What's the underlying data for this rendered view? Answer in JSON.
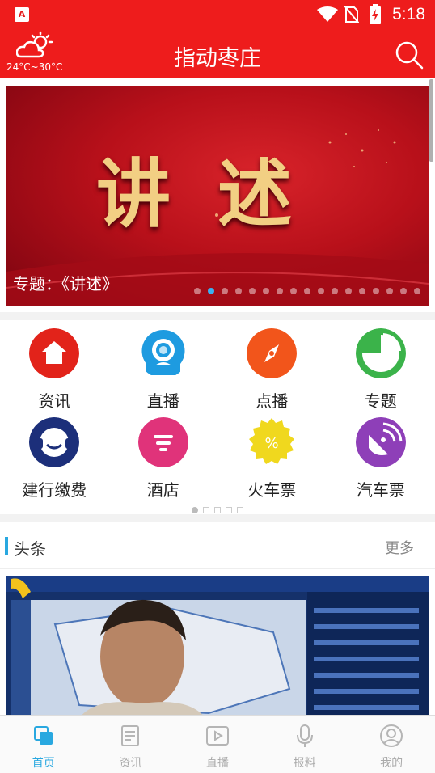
{
  "status_bar": {
    "app_icon": "A",
    "time": "5:18",
    "icons": [
      "wifi-icon",
      "no-sim-icon",
      "battery-charging-icon"
    ]
  },
  "app_bar": {
    "title": "指动枣庄",
    "weather_icon": "partly-cloudy-icon",
    "temperature": "24°C~30°C",
    "search_icon": "search-icon"
  },
  "banner": {
    "big_text": "讲述",
    "caption": "专题：《讲述》",
    "slide_count": 17,
    "active_slide": 2
  },
  "services": {
    "items": [
      {
        "label": "资讯",
        "icon": "home-icon",
        "color": "#e2231a"
      },
      {
        "label": "直播",
        "icon": "webcam-icon",
        "color": "#1e9be0"
      },
      {
        "label": "点播",
        "icon": "compass-icon",
        "color": "#f2551b"
      },
      {
        "label": "专题",
        "icon": "pie-chart-icon",
        "color": "#3bb34a"
      },
      {
        "label": "建行缴费",
        "icon": "headset-icon",
        "color": "#1c2f7a"
      },
      {
        "label": "酒店",
        "icon": "hotel-icon",
        "color": "#e0337a"
      },
      {
        "label": "火车票",
        "icon": "train-ticket-icon",
        "color": "#f0d81e"
      },
      {
        "label": "汽车票",
        "icon": "satellite-icon",
        "color": "#8e3fb8"
      }
    ],
    "page_count": 5,
    "active_page": 1
  },
  "headlines": {
    "title": "头条",
    "more": "更多"
  },
  "tab_bar": {
    "tabs": [
      {
        "label": "首页",
        "icon": "home-tab-icon",
        "active": true
      },
      {
        "label": "资讯",
        "icon": "news-icon",
        "active": false
      },
      {
        "label": "直播",
        "icon": "play-icon",
        "active": false
      },
      {
        "label": "报料",
        "icon": "microphone-icon",
        "active": false
      },
      {
        "label": "我的",
        "icon": "user-icon",
        "active": false
      }
    ]
  }
}
